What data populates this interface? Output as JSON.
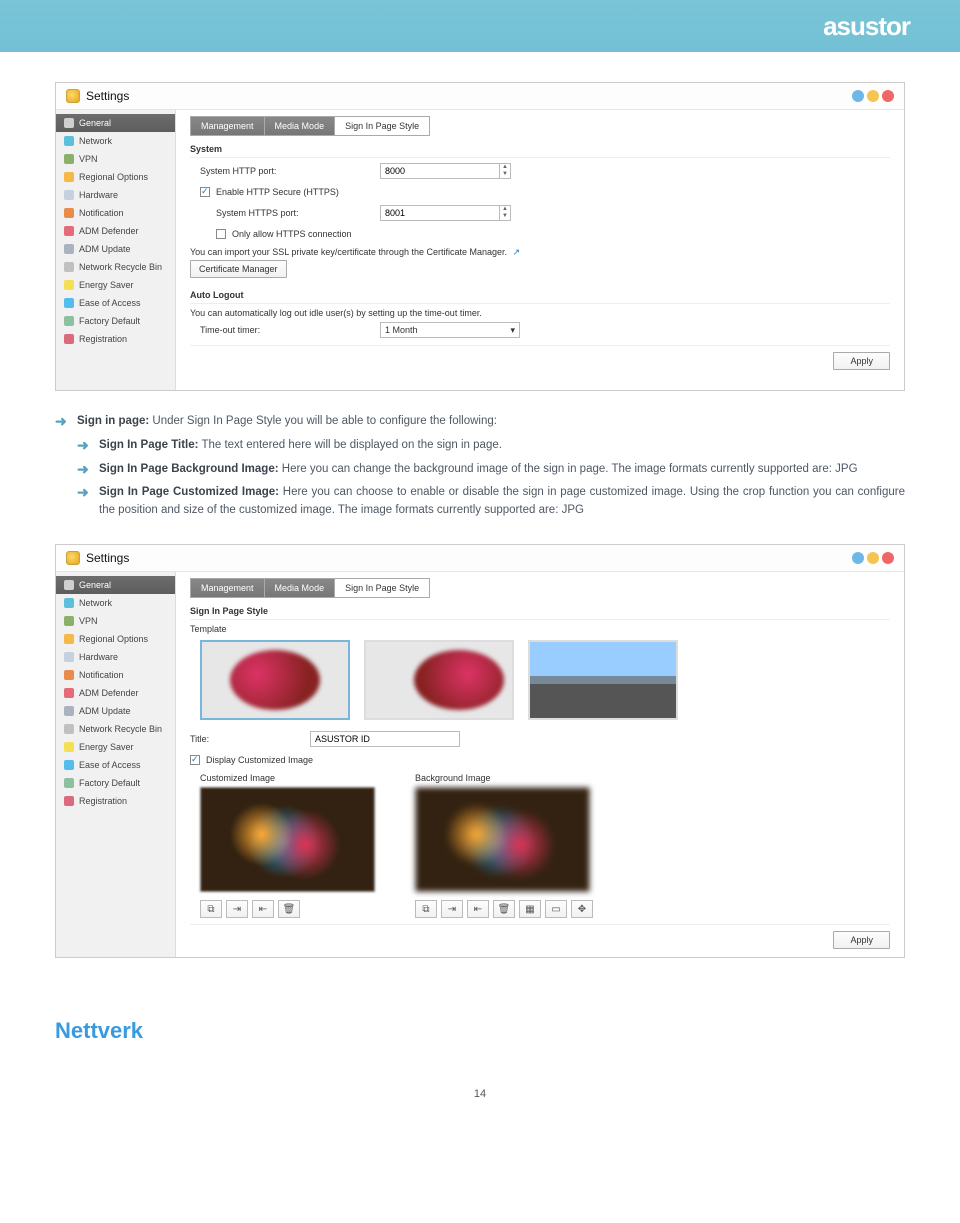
{
  "brand": "asustor",
  "sidebar": {
    "items": [
      {
        "label": "General"
      },
      {
        "label": "Network"
      },
      {
        "label": "VPN"
      },
      {
        "label": "Regional Options"
      },
      {
        "label": "Hardware"
      },
      {
        "label": "Notification"
      },
      {
        "label": "ADM Defender"
      },
      {
        "label": "ADM Update"
      },
      {
        "label": "Network Recycle Bin"
      },
      {
        "label": "Energy Saver"
      },
      {
        "label": "Ease of Access"
      },
      {
        "label": "Factory Default"
      },
      {
        "label": "Registration"
      }
    ]
  },
  "window": {
    "title": "Settings"
  },
  "tabs": {
    "management": "Management",
    "media_mode": "Media Mode",
    "sign_in": "Sign In Page Style"
  },
  "screenshot1": {
    "group_system": "System",
    "http_port_label": "System HTTP port:",
    "http_port_value": "8000",
    "enable_https_label": "Enable HTTP Secure (HTTPS)",
    "https_port_label": "System HTTPS port:",
    "https_port_value": "8001",
    "only_https_label": "Only allow HTTPS connection",
    "ssl_note": "You can import your SSL private key/certificate through the Certificate Manager.",
    "cert_mgr_btn": "Certificate Manager",
    "group_autologout": "Auto Logout",
    "autologout_note": "You can automatically log out idle user(s) by setting up the time-out timer.",
    "timeout_label": "Time-out timer:",
    "timeout_value": "1 Month",
    "apply_btn": "Apply"
  },
  "bullets": {
    "b1_title": "Sign in page:",
    "b1_text": " Under Sign In Page Style you will be able to configure the following:",
    "b2_title": "Sign In Page Title:",
    "b2_text": " The text entered here will be displayed on the sign in page.",
    "b3_title": "Sign In Page Background Image:",
    "b3_text": " Here you can change the background image of the sign in page. The image formats currently supported are: JPG",
    "b4_title": "Sign In Page Customized Image:",
    "b4_text": " Here you can choose to enable or disable the sign in page customized image. Using the crop function you can configure the position and size of the customized image. The image formats currently supported are: JPG"
  },
  "screenshot2": {
    "group_style": "Sign In Page Style",
    "template_label": "Template",
    "title_field_label": "Title:",
    "title_field_value": "ASUSTOR ID",
    "display_custom_label": "Display Customized Image",
    "cust_img_label": "Customized Image",
    "bg_img_label": "Background Image",
    "apply_btn": "Apply"
  },
  "section_heading": "Nettverk",
  "page_number": "14"
}
